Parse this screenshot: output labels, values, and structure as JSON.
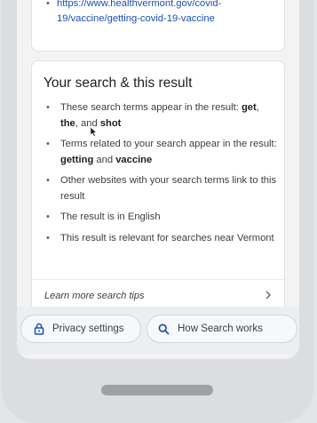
{
  "top_result": {
    "link_text": "https://www.healthvermont.gov/covid-19/vaccine/getting-covid-19-vaccine"
  },
  "search_result_card": {
    "title": "Your search & this result",
    "items": [
      {
        "segments": [
          {
            "text": "These search terms appear in the result: ",
            "bold": false
          },
          {
            "text": "get",
            "bold": true
          },
          {
            "text": ", ",
            "bold": false
          },
          {
            "text": "the",
            "bold": true
          },
          {
            "text": ", and ",
            "bold": false
          },
          {
            "text": "shot",
            "bold": true
          }
        ]
      },
      {
        "segments": [
          {
            "text": "Terms related to your search appear in the result: ",
            "bold": false
          },
          {
            "text": "getting",
            "bold": true
          },
          {
            "text": " and ",
            "bold": false
          },
          {
            "text": "vaccine",
            "bold": true
          }
        ]
      },
      {
        "segments": [
          {
            "text": "Other websites with your search terms link to this result",
            "bold": false
          }
        ]
      },
      {
        "segments": [
          {
            "text": "The result is in English",
            "bold": false
          }
        ]
      },
      {
        "segments": [
          {
            "text": "This result is relevant for searches near Vermont",
            "bold": false
          }
        ]
      }
    ],
    "learn_more_label": "Learn more search tips"
  },
  "bottom_bar": {
    "privacy_label": "Privacy settings",
    "how_search_label": "How Search works"
  },
  "icons": {
    "privacy": "lock-icon",
    "how_search": "search-icon",
    "learn_more": "chevron-right-icon"
  },
  "colors": {
    "link": "#1a4fb4",
    "text": "#3c4043",
    "heading": "#202124"
  }
}
